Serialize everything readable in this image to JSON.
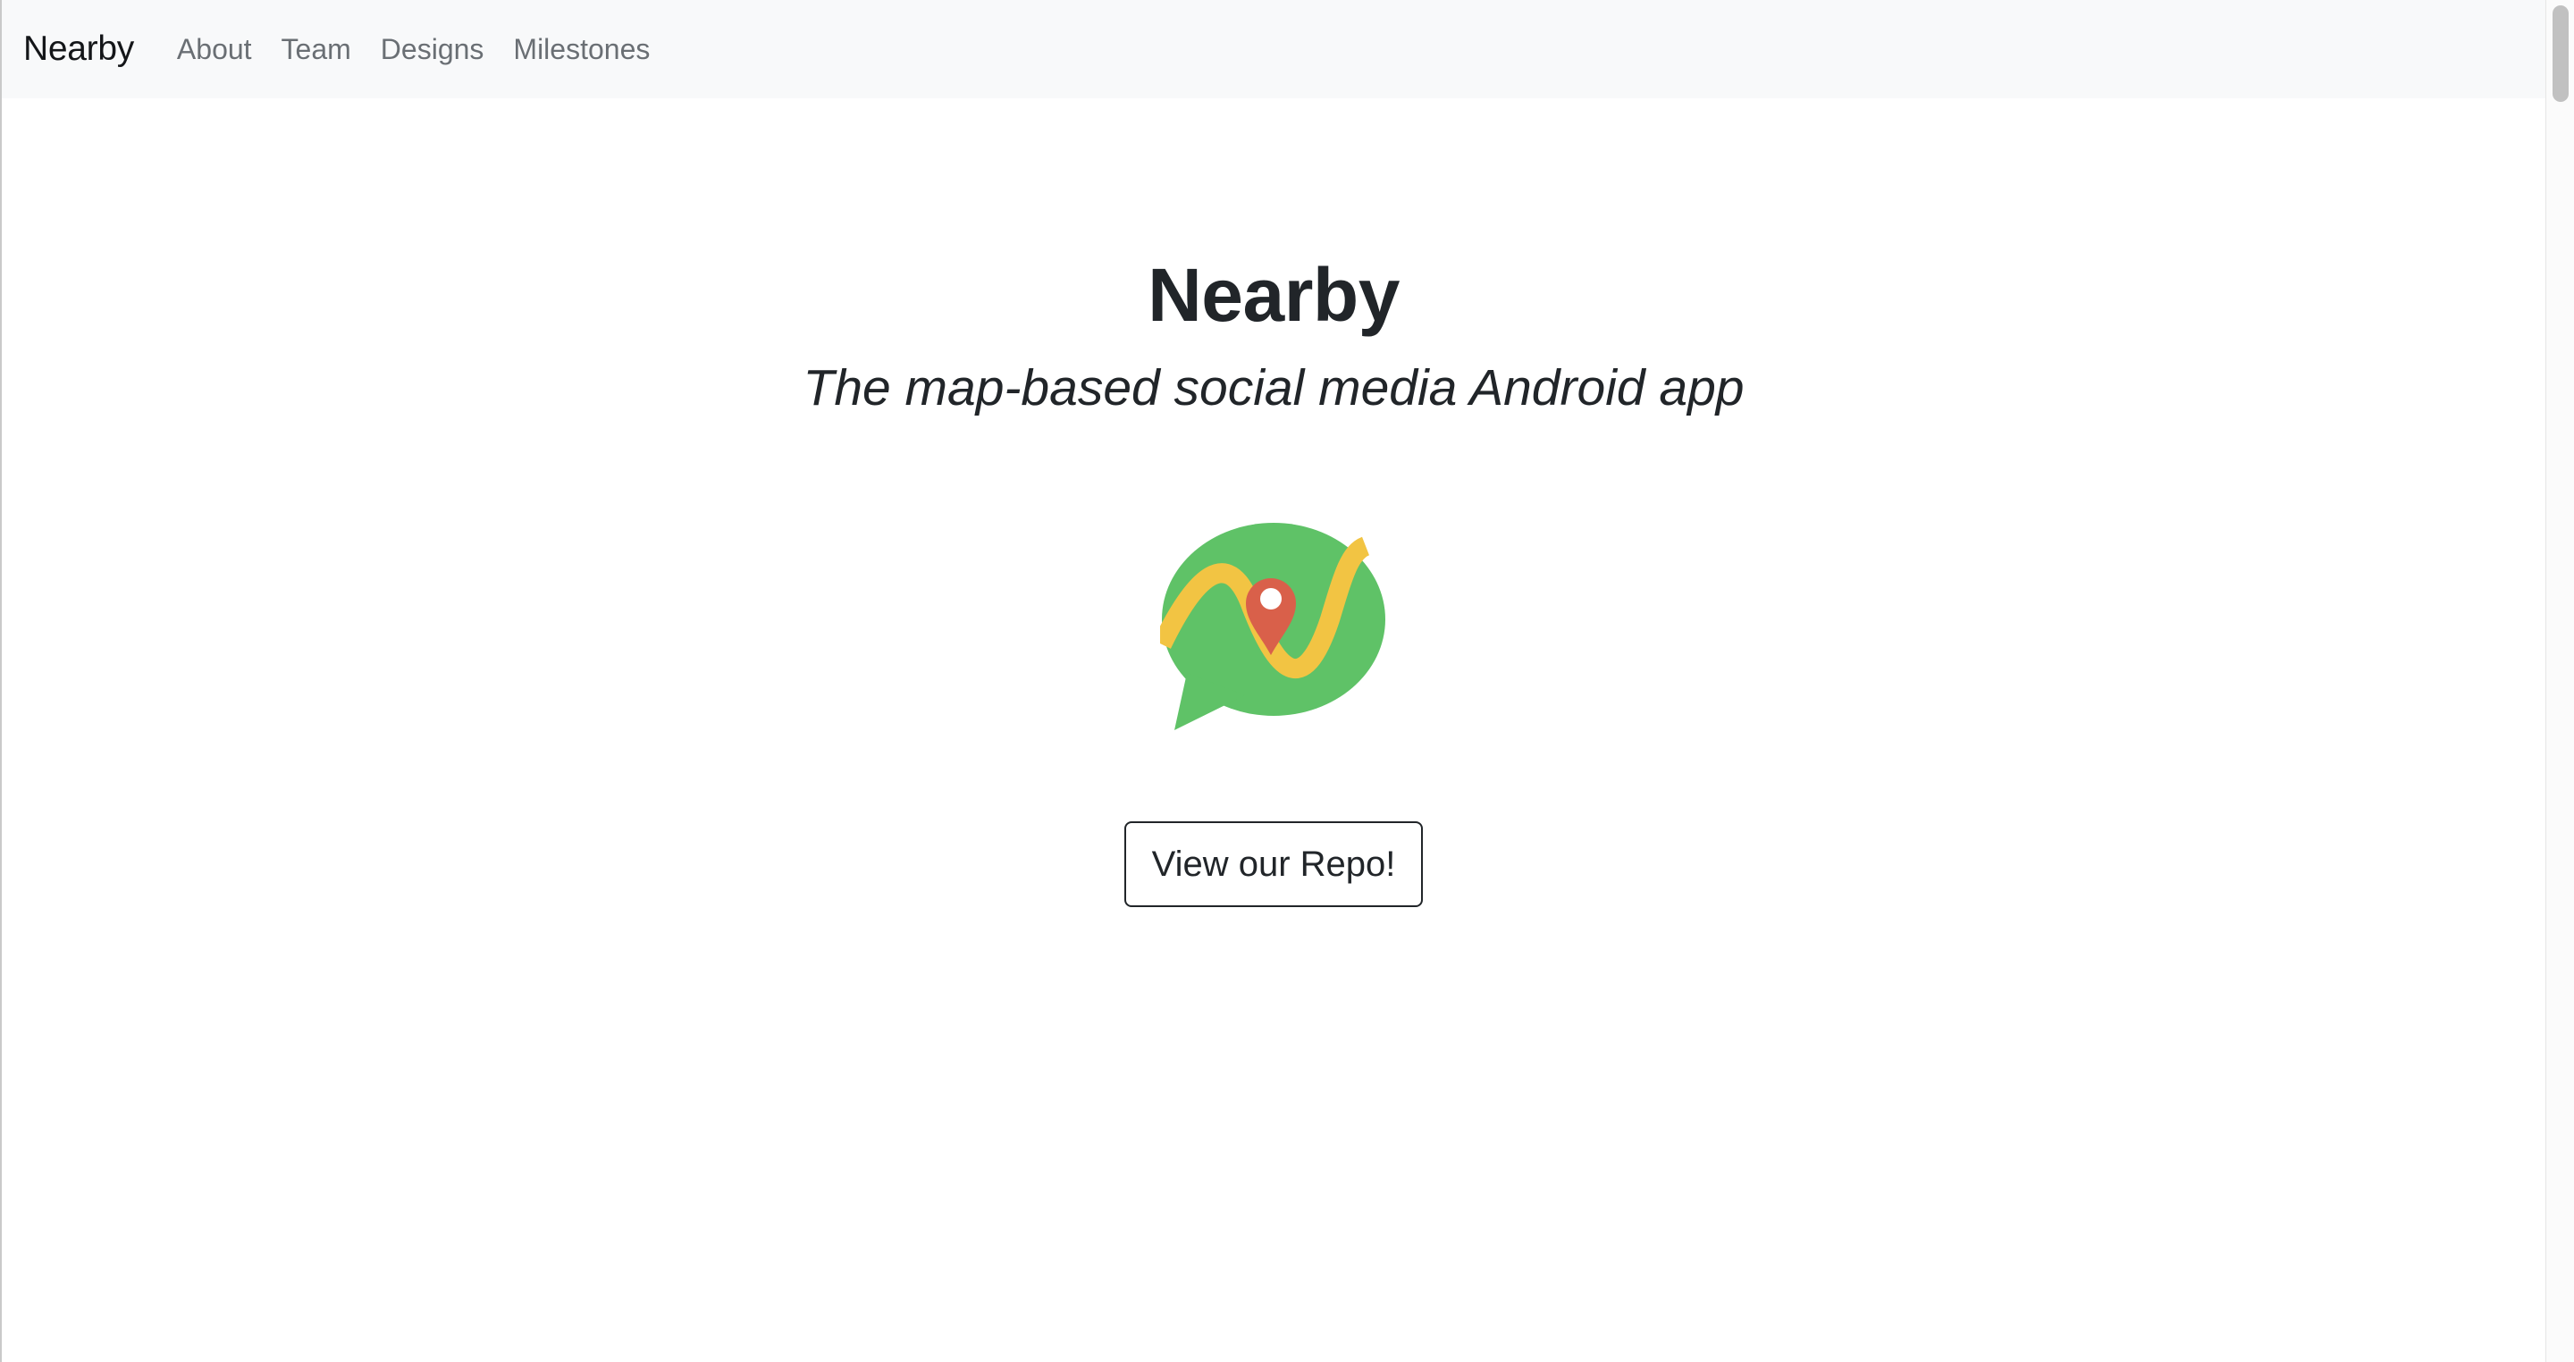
{
  "navbar": {
    "brand": "Nearby",
    "links": [
      {
        "label": "About"
      },
      {
        "label": "Team"
      },
      {
        "label": "Designs"
      },
      {
        "label": "Milestones"
      }
    ]
  },
  "hero": {
    "title": "Nearby",
    "subtitle": "The map-based social media Android app",
    "logo_icon": "map-chat-bubble-logo",
    "button_label": "View our Repo!"
  },
  "colors": {
    "navbar_bg": "#f8f9fa",
    "text": "#212529",
    "nav_link": "#6a6f74",
    "logo_green": "#5fc267",
    "logo_yellow": "#f2c443",
    "logo_pin_red": "#d9604a"
  }
}
